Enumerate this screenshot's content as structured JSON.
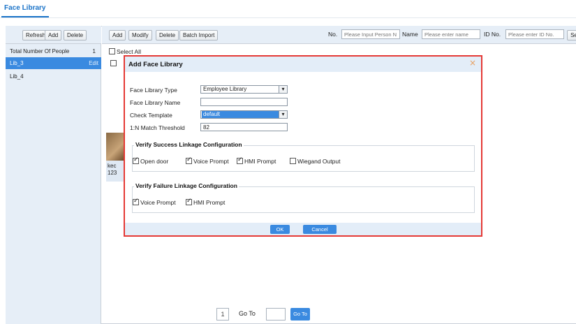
{
  "page": {
    "tab": "Face Library"
  },
  "left": {
    "toolbar": {
      "refresh": "Refresh",
      "add": "Add",
      "delete": "Delete"
    },
    "rows": [
      {
        "label": "Total Number Of People",
        "count": "1"
      },
      {
        "label": "Lib_3",
        "action": "Edit"
      },
      {
        "label": "Lib_4"
      }
    ]
  },
  "right": {
    "toolbar": {
      "add": "Add",
      "modify": "Modify",
      "delete": "Delete",
      "batch_import": "Batch Import"
    },
    "filters": {
      "no_label": "No.",
      "no_placeholder": "Please Input Person N",
      "name_label": "Name",
      "name_placeholder": "Please enter name",
      "id_label": "ID No.",
      "id_placeholder": "Please enter ID No.",
      "search_label": "Se"
    },
    "select_all": "Select All",
    "card": {
      "name": "kec",
      "id": "123"
    },
    "pager": {
      "page": "1",
      "goto_label": "Go To",
      "goto_value": "",
      "goto_button": "Go To"
    }
  },
  "modal": {
    "title": "Add Face Library",
    "close_glyph": "×",
    "fields": {
      "type_label": "Face Library Type",
      "type_value": "Employee Library",
      "name_label": "Face Library Name",
      "name_value": "",
      "template_label": "Check Template",
      "template_value": "default",
      "threshold_label": "1:N Match Threshold",
      "threshold_value": "82"
    },
    "success": {
      "title": "Verify Success Linkage Configuration",
      "options": [
        {
          "label": "Open door",
          "checked": true
        },
        {
          "label": "Voice Prompt",
          "checked": true
        },
        {
          "label": "HMI Prompt",
          "checked": true
        },
        {
          "label": "Wiegand Output",
          "checked": false
        }
      ]
    },
    "failure": {
      "title": "Verify Failure Linkage Configuration",
      "options": [
        {
          "label": "Voice Prompt",
          "checked": true
        },
        {
          "label": "HMI Prompt",
          "checked": true
        }
      ]
    },
    "buttons": {
      "ok": "OK",
      "cancel": "Cancel"
    }
  },
  "colors": {
    "accent": "#3a8ae0",
    "highlight_border": "#e53935",
    "panel": "#e6eef7"
  }
}
